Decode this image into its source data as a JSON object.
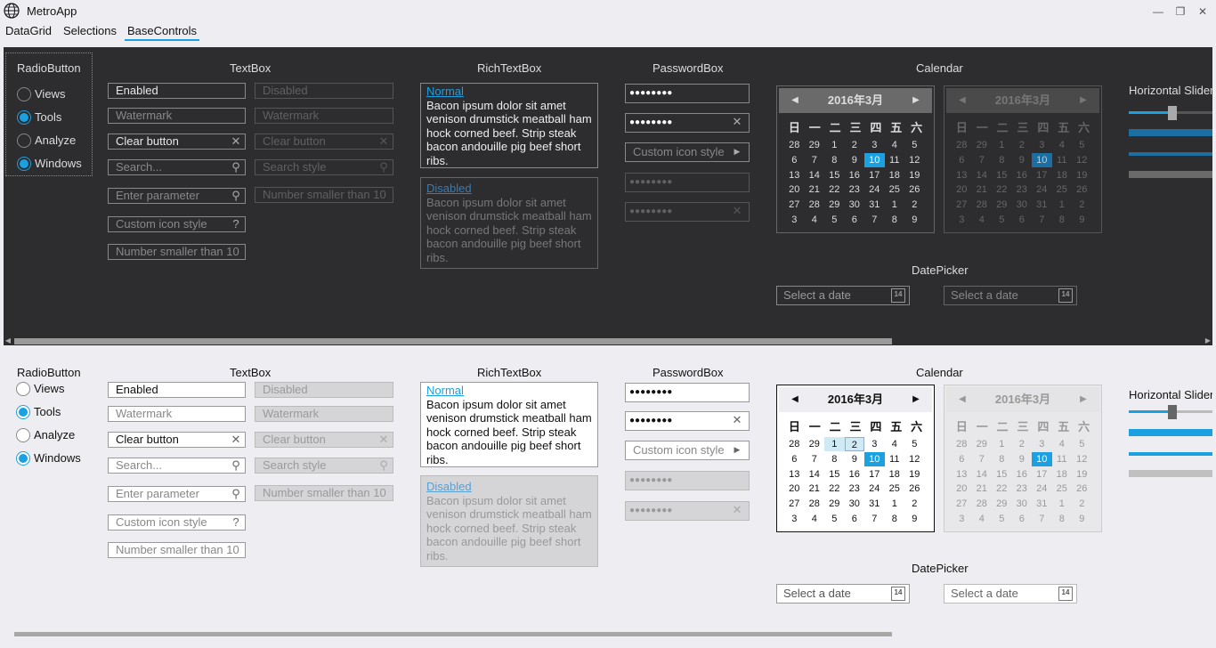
{
  "window": {
    "title": "MetroApp",
    "minimize": "—",
    "maximize": "❐",
    "close": "✕"
  },
  "tabs": [
    {
      "label": "DataGrid"
    },
    {
      "label": "Selections"
    },
    {
      "label": "BaseControls"
    }
  ],
  "selected_tab": "BaseControls",
  "colors": {
    "accent": "#1ba1e2",
    "dark_bg": "#2d2d30",
    "light_bg": "#eeeef2"
  },
  "sections": {
    "radio_title": "RadioButton",
    "textbox_title": "TextBox",
    "richtext_title": "RichTextBox",
    "password_title": "PasswordBox",
    "calendar_title": "Calendar",
    "datepicker_title": "DatePicker",
    "slider_title": "Horizontal Slider"
  },
  "radio": [
    {
      "label": "Views",
      "checked": false
    },
    {
      "label": "Tools",
      "checked": true
    },
    {
      "label": "Analyze",
      "checked": false
    },
    {
      "label": "Windows",
      "checked": true
    }
  ],
  "textbox": {
    "left": [
      {
        "text": "Enabled",
        "icon": ""
      },
      {
        "text": "Watermark",
        "icon": ""
      },
      {
        "text": "Clear button",
        "icon": "✕"
      },
      {
        "text": "Search...",
        "icon": "⚲"
      },
      {
        "text": "Enter parameter",
        "icon": "⚲"
      },
      {
        "text": "Custom icon style",
        "icon": "?"
      },
      {
        "text": "Number smaller than 10",
        "icon": ""
      }
    ],
    "right": [
      {
        "text": "Disabled",
        "icon": ""
      },
      {
        "text": "Watermark",
        "icon": ""
      },
      {
        "text": "Clear button",
        "icon": "✕"
      },
      {
        "text": "Search style",
        "icon": "⚲"
      },
      {
        "text": "Number smaller than 10",
        "icon": ""
      }
    ]
  },
  "richtext": {
    "normal_link": "Normal",
    "disabled_link": "Disabled",
    "body": "Bacon ipsum dolor sit amet venison drumstick meatball ham hock corned beef. Strip steak bacon andouille pig beef short ribs."
  },
  "password": {
    "dots": "●●●●●●●●",
    "custom_icon_style": "Custom icon style",
    "clear_icon": "✕",
    "arrow_icon": "▶"
  },
  "calendar": {
    "month": "2016年3月",
    "weekdays": [
      "日",
      "一",
      "二",
      "三",
      "四",
      "五",
      "六"
    ],
    "rows": [
      [
        "28",
        "29",
        "1",
        "2",
        "3",
        "4",
        "5"
      ],
      [
        "6",
        "7",
        "8",
        "9",
        "10",
        "11",
        "12"
      ],
      [
        "13",
        "14",
        "15",
        "16",
        "17",
        "18",
        "19"
      ],
      [
        "20",
        "21",
        "22",
        "23",
        "24",
        "25",
        "26"
      ],
      [
        "27",
        "28",
        "29",
        "30",
        "31",
        "1",
        "2"
      ],
      [
        "3",
        "4",
        "5",
        "6",
        "7",
        "8",
        "9"
      ]
    ],
    "today": "10"
  },
  "datepicker": {
    "placeholder": "Select a date",
    "icon_text": "14"
  },
  "slider": {
    "value": 0.15
  }
}
